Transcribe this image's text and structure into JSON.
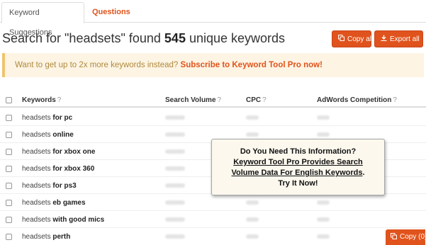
{
  "tabs": [
    {
      "label": "Keyword Suggestions"
    },
    {
      "label": "Questions"
    }
  ],
  "headline": {
    "prefix": "Search for \"headsets\" found ",
    "count": "545",
    "suffix": " unique keywords"
  },
  "buttons": {
    "copy_all": "Copy all",
    "export_all": "Export all",
    "copy_footer": "Copy (0)"
  },
  "promo": {
    "text": "Want to get up to 2x more keywords instead? ",
    "link": "Subscribe to Keyword Tool Pro now!"
  },
  "table": {
    "headers": [
      "Keywords",
      "Search Volume",
      "CPC",
      "AdWords Competition"
    ],
    "help_mark": "?",
    "rows": [
      {
        "base": "headsets ",
        "suffix": "for pc"
      },
      {
        "base": "headsets ",
        "suffix": "online"
      },
      {
        "base": "headsets ",
        "suffix": "for xbox one"
      },
      {
        "base": "headsets ",
        "suffix": "for xbox 360"
      },
      {
        "base": "headsets ",
        "suffix": "for ps3"
      },
      {
        "base": "headsets ",
        "suffix": "eb games"
      },
      {
        "base": "headsets ",
        "suffix": "with good mics"
      },
      {
        "base": "headsets ",
        "suffix": "perth"
      }
    ]
  },
  "popup": {
    "line1": "Do You Need This Information?",
    "link_line1": "Keyword Tool Pro Provides Search",
    "link_line2": "Volume Data For English Keywords",
    "line3_end": ".",
    "line4": "Try It Now!"
  },
  "colors": {
    "accent": "#e0531c",
    "promo_bg": "#fdf4e3",
    "promo_text": "#b08a3e"
  },
  "icons": {
    "copy": "copy-icon",
    "export": "export-icon",
    "caret": "caret-down-icon",
    "help": "help-icon"
  }
}
